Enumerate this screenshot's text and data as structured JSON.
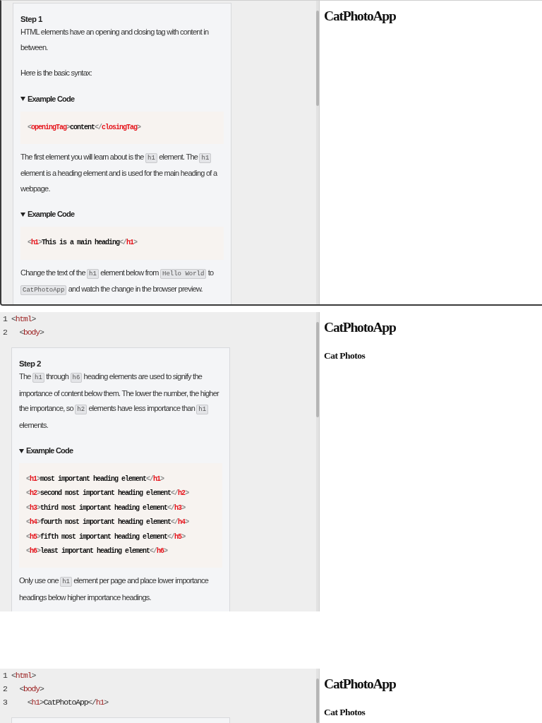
{
  "screens": [
    {
      "bordered": true,
      "editor": {
        "step_card": {
          "title": "Step 1",
          "blocks": [
            {
              "kind": "paragraph",
              "parts": [
                {
                  "kind": "text",
                  "text": "HTML elements have an opening and closing tag with content in between."
                }
              ]
            },
            {
              "kind": "paragraph",
              "parts": [
                {
                  "kind": "text",
                  "text": "Here is the basic syntax:"
                }
              ]
            },
            {
              "kind": "example",
              "label": "Example Code",
              "expanded": true,
              "code_lines": [
                "<openingTag>content</closingTag>"
              ]
            },
            {
              "kind": "paragraph",
              "parts": [
                {
                  "kind": "text",
                  "text": "The first element you will learn about is the "
                },
                {
                  "kind": "code",
                  "text": "h1"
                },
                {
                  "kind": "text",
                  "text": " element. The "
                },
                {
                  "kind": "code",
                  "text": "h1"
                },
                {
                  "kind": "text",
                  "text": " element is a heading element and is used for the main heading of a webpage."
                }
              ]
            },
            {
              "kind": "example",
              "label": "Example Code",
              "expanded": true,
              "code_lines": [
                "<h1>This is a main heading</h1>"
              ]
            },
            {
              "kind": "paragraph",
              "parts": [
                {
                  "kind": "text",
                  "text": "Change the text of the "
                },
                {
                  "kind": "code",
                  "text": "h1"
                },
                {
                  "kind": "text",
                  "text": " element below from "
                },
                {
                  "kind": "code",
                  "text": "Hello World"
                },
                {
                  "kind": "text",
                  "text": " to "
                },
                {
                  "kind": "code",
                  "text": "CatPhotoApp"
                },
                {
                  "kind": "text",
                  "text": " and watch the change in the browser preview."
                }
              ]
            }
          ]
        }
      },
      "preview": {
        "headings": [
          {
            "kind": "h1",
            "text": "CatPhotoApp"
          }
        ]
      }
    },
    {
      "editor": {
        "code_lines": [
          {
            "number": "1",
            "code": "<html>"
          },
          {
            "number": "2",
            "code": "  <body>"
          }
        ],
        "step_card": {
          "title": "Step 2",
          "blocks": [
            {
              "kind": "paragraph",
              "parts": [
                {
                  "kind": "text",
                  "text": "The "
                },
                {
                  "kind": "code",
                  "text": "h1"
                },
                {
                  "kind": "text",
                  "text": " through "
                },
                {
                  "kind": "code",
                  "text": "h6"
                },
                {
                  "kind": "text",
                  "text": " heading elements are used to signify the importance of content below them. The lower the number, the higher the importance, so "
                },
                {
                  "kind": "code",
                  "text": "h2"
                },
                {
                  "kind": "text",
                  "text": " elements have less importance than "
                },
                {
                  "kind": "code",
                  "text": "h1"
                },
                {
                  "kind": "text",
                  "text": " elements."
                }
              ]
            },
            {
              "kind": "example",
              "label": "Example Code",
              "expanded": true,
              "code_lines": [
                "<h1>most important heading element</h1>",
                "<h2>second most important heading element</h2>",
                "<h3>third most important heading element</h3>",
                "<h4>fourth most important heading element</h4>",
                "<h5>fifth most important heading element</h5>",
                "<h6>least important heading element</h6>"
              ]
            },
            {
              "kind": "paragraph",
              "parts": [
                {
                  "kind": "text",
                  "text": "Only use one "
                },
                {
                  "kind": "code",
                  "text": "h1"
                },
                {
                  "kind": "text",
                  "text": " element per page and place lower importance headings below higher importance headings."
                }
              ]
            }
          ]
        }
      },
      "preview": {
        "headings": [
          {
            "kind": "h1",
            "text": "CatPhotoApp"
          },
          {
            "kind": "h2",
            "text": "Cat Photos"
          }
        ]
      }
    },
    {
      "editor": {
        "code_lines": [
          {
            "number": "1",
            "code": "<html>"
          },
          {
            "number": "2",
            "code": "  <body>"
          },
          {
            "number": "3",
            "code": "    <h1>CatPhotoApp</h1>"
          }
        ],
        "step_card": {
          "shown": true
        }
      },
      "preview": {
        "headings": [
          {
            "kind": "h1",
            "text": "CatPhotoApp"
          },
          {
            "kind": "h2",
            "text": "Cat Photos"
          }
        ]
      }
    }
  ]
}
